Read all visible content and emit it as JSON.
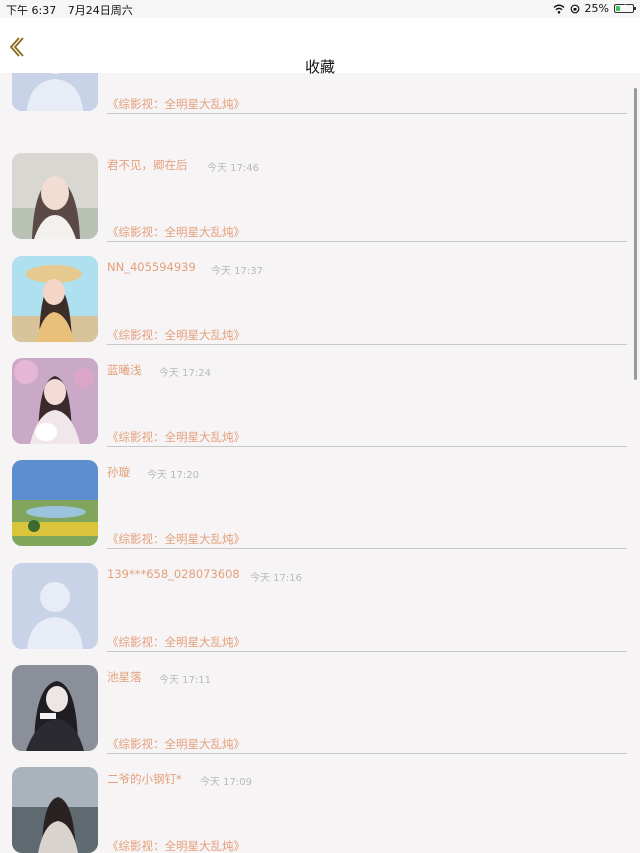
{
  "status": {
    "time": "下午 6:37",
    "date": "7月24日周六",
    "battery": "25%",
    "battery_level": 0.25
  },
  "nav": {
    "title": "收藏"
  },
  "items": [
    {
      "name": "",
      "time": "",
      "title": "《综影视：全明星大乱炖》",
      "avatar": "default-avatar"
    },
    {
      "name": "君不见，卿在后",
      "time": "今天 17:46",
      "title": "《综影视：全明星大乱炖》",
      "avatar": "portrait"
    },
    {
      "name": "NN_405594939",
      "time": "今天 17:37",
      "title": "《综影视：全明星大乱炖》",
      "avatar": "portrait"
    },
    {
      "name": "蓝曦浅",
      "time": "今天 17:24",
      "title": "《综影视：全明星大乱炖》",
      "avatar": "portrait"
    },
    {
      "name": "孙璇",
      "time": "今天 17:20",
      "title": "《综影视：全明星大乱炖》",
      "avatar": "landscape"
    },
    {
      "name": "139***658_028073608",
      "time": "今天 17:16",
      "title": "《综影视：全明星大乱炖》",
      "avatar": "default-avatar"
    },
    {
      "name": "池星落",
      "time": "今天 17:11",
      "title": "《综影视：全明星大乱炖》",
      "avatar": "portrait"
    },
    {
      "name": "二爷的小钢钉*",
      "time": "今天 17:09",
      "title": "《综影视：全明星大乱炖》",
      "avatar": "portrait"
    }
  ]
}
